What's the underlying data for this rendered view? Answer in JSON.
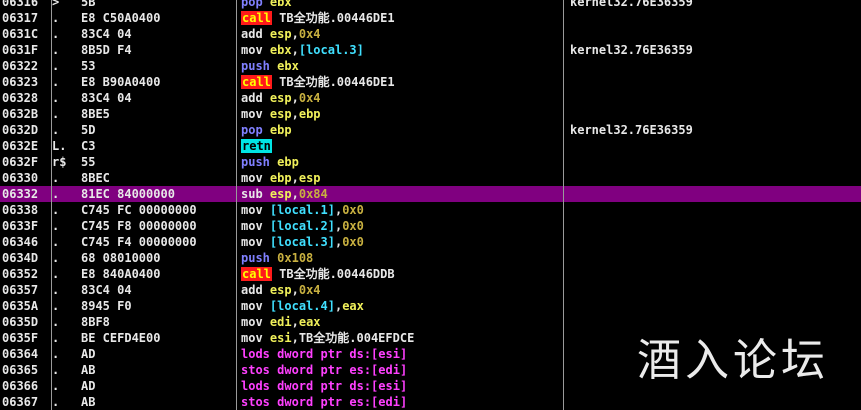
{
  "colors": {
    "background": "#000000",
    "selected_row": "#800080",
    "call_bg": "#ff1a1a",
    "call_fg": "#ffff00",
    "retn_bg": "#00e5e5",
    "push_pop": "#8080ff",
    "string_ops": "#ff40ff",
    "register": "#f0f05a",
    "immediate": "#c8b040",
    "local": "#40e0ff"
  },
  "selected_row_index": 12,
  "rows": [
    {
      "addr": "06316",
      "mark": ">",
      "bytes": "5B",
      "tokens": [
        {
          "t": "pop",
          "c": "mn-pop"
        },
        {
          "t": " ",
          "c": "t-plain"
        },
        {
          "t": "ebx",
          "c": "t-reg"
        }
      ],
      "comment": "kernel32.76E36359"
    },
    {
      "addr": "06317",
      "mark": ".",
      "bytes": "E8 C50A0400",
      "tokens": [
        {
          "t": "call",
          "c": "mn-call"
        },
        {
          "t": " TB全功能.00446DE1",
          "c": "t-plain"
        }
      ],
      "comment": ""
    },
    {
      "addr": "0631C",
      "mark": ".",
      "bytes": "83C4 04",
      "tokens": [
        {
          "t": "add",
          "c": "mn-add"
        },
        {
          "t": " ",
          "c": "t-plain"
        },
        {
          "t": "esp",
          "c": "t-reg"
        },
        {
          "t": ",",
          "c": "t-plain"
        },
        {
          "t": "0x4",
          "c": "t-num"
        }
      ],
      "comment": ""
    },
    {
      "addr": "0631F",
      "mark": ".",
      "bytes": "8B5D F4",
      "tokens": [
        {
          "t": "mov",
          "c": "mn-mov"
        },
        {
          "t": " ",
          "c": "t-plain"
        },
        {
          "t": "ebx",
          "c": "t-reg"
        },
        {
          "t": ",",
          "c": "t-plain"
        },
        {
          "t": "[local.3]",
          "c": "t-mem"
        }
      ],
      "comment": "kernel32.76E36359"
    },
    {
      "addr": "06322",
      "mark": ".",
      "bytes": "53",
      "tokens": [
        {
          "t": "push",
          "c": "mn-push"
        },
        {
          "t": " ",
          "c": "t-plain"
        },
        {
          "t": "ebx",
          "c": "t-reg"
        }
      ],
      "comment": ""
    },
    {
      "addr": "06323",
      "mark": ".",
      "bytes": "E8 B90A0400",
      "tokens": [
        {
          "t": "call",
          "c": "mn-call"
        },
        {
          "t": " TB全功能.00446DE1",
          "c": "t-plain"
        }
      ],
      "comment": ""
    },
    {
      "addr": "06328",
      "mark": ".",
      "bytes": "83C4 04",
      "tokens": [
        {
          "t": "add",
          "c": "mn-add"
        },
        {
          "t": " ",
          "c": "t-plain"
        },
        {
          "t": "esp",
          "c": "t-reg"
        },
        {
          "t": ",",
          "c": "t-plain"
        },
        {
          "t": "0x4",
          "c": "t-num"
        }
      ],
      "comment": ""
    },
    {
      "addr": "0632B",
      "mark": ".",
      "bytes": "8BE5",
      "tokens": [
        {
          "t": "mov",
          "c": "mn-mov"
        },
        {
          "t": " ",
          "c": "t-plain"
        },
        {
          "t": "esp",
          "c": "t-reg"
        },
        {
          "t": ",",
          "c": "t-plain"
        },
        {
          "t": "ebp",
          "c": "t-reg"
        }
      ],
      "comment": ""
    },
    {
      "addr": "0632D",
      "mark": ".",
      "bytes": "5D",
      "tokens": [
        {
          "t": "pop",
          "c": "mn-pop"
        },
        {
          "t": " ",
          "c": "t-plain"
        },
        {
          "t": "ebp",
          "c": "t-reg"
        }
      ],
      "comment": "kernel32.76E36359"
    },
    {
      "addr": "0632E",
      "mark": "L.",
      "bytes": "C3",
      "tokens": [
        {
          "t": "retn",
          "c": "mn-retn"
        }
      ],
      "comment": ""
    },
    {
      "addr": "0632F",
      "mark": "r$",
      "bytes": "55",
      "tokens": [
        {
          "t": "push",
          "c": "mn-push"
        },
        {
          "t": " ",
          "c": "t-plain"
        },
        {
          "t": "ebp",
          "c": "t-reg"
        }
      ],
      "comment": ""
    },
    {
      "addr": "06330",
      "mark": ".",
      "bytes": "8BEC",
      "tokens": [
        {
          "t": "mov",
          "c": "mn-mov"
        },
        {
          "t": " ",
          "c": "t-plain"
        },
        {
          "t": "ebp",
          "c": "t-reg"
        },
        {
          "t": ",",
          "c": "t-plain"
        },
        {
          "t": "esp",
          "c": "t-reg"
        }
      ],
      "comment": ""
    },
    {
      "addr": "06332",
      "mark": ".",
      "bytes": "81EC 84000000",
      "tokens": [
        {
          "t": "sub",
          "c": "mn-sub"
        },
        {
          "t": " ",
          "c": "t-plain"
        },
        {
          "t": "esp",
          "c": "t-reg"
        },
        {
          "t": ",",
          "c": "t-plain"
        },
        {
          "t": "0x84",
          "c": "t-num"
        }
      ],
      "comment": ""
    },
    {
      "addr": "06338",
      "mark": ".",
      "bytes": "C745 FC 00000000",
      "tokens": [
        {
          "t": "mov",
          "c": "mn-mov"
        },
        {
          "t": " ",
          "c": "t-plain"
        },
        {
          "t": "[local.1]",
          "c": "t-mem"
        },
        {
          "t": ",",
          "c": "t-plain"
        },
        {
          "t": "0x0",
          "c": "t-num"
        }
      ],
      "comment": ""
    },
    {
      "addr": "0633F",
      "mark": ".",
      "bytes": "C745 F8 00000000",
      "tokens": [
        {
          "t": "mov",
          "c": "mn-mov"
        },
        {
          "t": " ",
          "c": "t-plain"
        },
        {
          "t": "[local.2]",
          "c": "t-mem"
        },
        {
          "t": ",",
          "c": "t-plain"
        },
        {
          "t": "0x0",
          "c": "t-num"
        }
      ],
      "comment": ""
    },
    {
      "addr": "06346",
      "mark": ".",
      "bytes": "C745 F4 00000000",
      "tokens": [
        {
          "t": "mov",
          "c": "mn-mov"
        },
        {
          "t": " ",
          "c": "t-plain"
        },
        {
          "t": "[local.3]",
          "c": "t-mem"
        },
        {
          "t": ",",
          "c": "t-plain"
        },
        {
          "t": "0x0",
          "c": "t-num"
        }
      ],
      "comment": ""
    },
    {
      "addr": "0634D",
      "mark": ".",
      "bytes": "68 08010000",
      "tokens": [
        {
          "t": "push",
          "c": "mn-push"
        },
        {
          "t": " ",
          "c": "t-plain"
        },
        {
          "t": "0x108",
          "c": "t-num"
        }
      ],
      "comment": ""
    },
    {
      "addr": "06352",
      "mark": ".",
      "bytes": "E8 840A0400",
      "tokens": [
        {
          "t": "call",
          "c": "mn-call"
        },
        {
          "t": " TB全功能.00446DDB",
          "c": "t-plain"
        }
      ],
      "comment": ""
    },
    {
      "addr": "06357",
      "mark": ".",
      "bytes": "83C4 04",
      "tokens": [
        {
          "t": "add",
          "c": "mn-add"
        },
        {
          "t": " ",
          "c": "t-plain"
        },
        {
          "t": "esp",
          "c": "t-reg"
        },
        {
          "t": ",",
          "c": "t-plain"
        },
        {
          "t": "0x4",
          "c": "t-num"
        }
      ],
      "comment": ""
    },
    {
      "addr": "0635A",
      "mark": ".",
      "bytes": "8945 F0",
      "tokens": [
        {
          "t": "mov",
          "c": "mn-mov"
        },
        {
          "t": " ",
          "c": "t-plain"
        },
        {
          "t": "[local.4]",
          "c": "t-mem"
        },
        {
          "t": ",",
          "c": "t-plain"
        },
        {
          "t": "eax",
          "c": "t-reg"
        }
      ],
      "comment": ""
    },
    {
      "addr": "0635D",
      "mark": ".",
      "bytes": "8BF8",
      "tokens": [
        {
          "t": "mov",
          "c": "mn-mov"
        },
        {
          "t": " ",
          "c": "t-plain"
        },
        {
          "t": "edi",
          "c": "t-reg"
        },
        {
          "t": ",",
          "c": "t-plain"
        },
        {
          "t": "eax",
          "c": "t-reg"
        }
      ],
      "comment": ""
    },
    {
      "addr": "0635F",
      "mark": ".",
      "bytes": "BE CEFD4E00",
      "tokens": [
        {
          "t": "mov",
          "c": "mn-mov"
        },
        {
          "t": " ",
          "c": "t-plain"
        },
        {
          "t": "esi",
          "c": "t-reg"
        },
        {
          "t": ",TB全功能.004EFDCE",
          "c": "t-plain"
        }
      ],
      "comment": ""
    },
    {
      "addr": "06364",
      "mark": ".",
      "bytes": "AD",
      "tokens": [
        {
          "t": "lods dword ptr ds:[esi]",
          "c": "mn-lods"
        }
      ],
      "comment": ""
    },
    {
      "addr": "06365",
      "mark": ".",
      "bytes": "AB",
      "tokens": [
        {
          "t": "stos dword ptr es:[edi]",
          "c": "mn-stos"
        }
      ],
      "comment": ""
    },
    {
      "addr": "06366",
      "mark": ".",
      "bytes": "AD",
      "tokens": [
        {
          "t": "lods dword ptr ds:[esi]",
          "c": "mn-lods"
        }
      ],
      "comment": ""
    },
    {
      "addr": "06367",
      "mark": ".",
      "bytes": "AB",
      "tokens": [
        {
          "t": "stos dword ptr es:[edi]",
          "c": "mn-stos"
        }
      ],
      "comment": ""
    }
  ],
  "watermark": "酒入论坛"
}
